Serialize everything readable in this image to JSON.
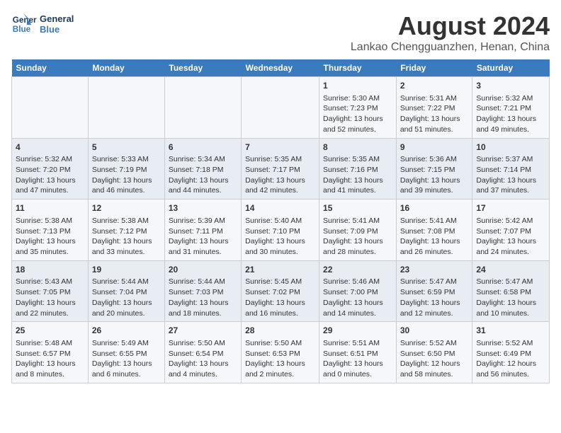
{
  "header": {
    "logo_line1": "General",
    "logo_line2": "Blue",
    "title": "August 2024",
    "subtitle": "Lankao Chengguanzhen, Henan, China"
  },
  "days_of_week": [
    "Sunday",
    "Monday",
    "Tuesday",
    "Wednesday",
    "Thursday",
    "Friday",
    "Saturday"
  ],
  "weeks": [
    [
      {
        "day": "",
        "text": ""
      },
      {
        "day": "",
        "text": ""
      },
      {
        "day": "",
        "text": ""
      },
      {
        "day": "",
        "text": ""
      },
      {
        "day": "1",
        "text": "Sunrise: 5:30 AM\nSunset: 7:23 PM\nDaylight: 13 hours and 52 minutes."
      },
      {
        "day": "2",
        "text": "Sunrise: 5:31 AM\nSunset: 7:22 PM\nDaylight: 13 hours and 51 minutes."
      },
      {
        "day": "3",
        "text": "Sunrise: 5:32 AM\nSunset: 7:21 PM\nDaylight: 13 hours and 49 minutes."
      }
    ],
    [
      {
        "day": "4",
        "text": "Sunrise: 5:32 AM\nSunset: 7:20 PM\nDaylight: 13 hours and 47 minutes."
      },
      {
        "day": "5",
        "text": "Sunrise: 5:33 AM\nSunset: 7:19 PM\nDaylight: 13 hours and 46 minutes."
      },
      {
        "day": "6",
        "text": "Sunrise: 5:34 AM\nSunset: 7:18 PM\nDaylight: 13 hours and 44 minutes."
      },
      {
        "day": "7",
        "text": "Sunrise: 5:35 AM\nSunset: 7:17 PM\nDaylight: 13 hours and 42 minutes."
      },
      {
        "day": "8",
        "text": "Sunrise: 5:35 AM\nSunset: 7:16 PM\nDaylight: 13 hours and 41 minutes."
      },
      {
        "day": "9",
        "text": "Sunrise: 5:36 AM\nSunset: 7:15 PM\nDaylight: 13 hours and 39 minutes."
      },
      {
        "day": "10",
        "text": "Sunrise: 5:37 AM\nSunset: 7:14 PM\nDaylight: 13 hours and 37 minutes."
      }
    ],
    [
      {
        "day": "11",
        "text": "Sunrise: 5:38 AM\nSunset: 7:13 PM\nDaylight: 13 hours and 35 minutes."
      },
      {
        "day": "12",
        "text": "Sunrise: 5:38 AM\nSunset: 7:12 PM\nDaylight: 13 hours and 33 minutes."
      },
      {
        "day": "13",
        "text": "Sunrise: 5:39 AM\nSunset: 7:11 PM\nDaylight: 13 hours and 31 minutes."
      },
      {
        "day": "14",
        "text": "Sunrise: 5:40 AM\nSunset: 7:10 PM\nDaylight: 13 hours and 30 minutes."
      },
      {
        "day": "15",
        "text": "Sunrise: 5:41 AM\nSunset: 7:09 PM\nDaylight: 13 hours and 28 minutes."
      },
      {
        "day": "16",
        "text": "Sunrise: 5:41 AM\nSunset: 7:08 PM\nDaylight: 13 hours and 26 minutes."
      },
      {
        "day": "17",
        "text": "Sunrise: 5:42 AM\nSunset: 7:07 PM\nDaylight: 13 hours and 24 minutes."
      }
    ],
    [
      {
        "day": "18",
        "text": "Sunrise: 5:43 AM\nSunset: 7:05 PM\nDaylight: 13 hours and 22 minutes."
      },
      {
        "day": "19",
        "text": "Sunrise: 5:44 AM\nSunset: 7:04 PM\nDaylight: 13 hours and 20 minutes."
      },
      {
        "day": "20",
        "text": "Sunrise: 5:44 AM\nSunset: 7:03 PM\nDaylight: 13 hours and 18 minutes."
      },
      {
        "day": "21",
        "text": "Sunrise: 5:45 AM\nSunset: 7:02 PM\nDaylight: 13 hours and 16 minutes."
      },
      {
        "day": "22",
        "text": "Sunrise: 5:46 AM\nSunset: 7:00 PM\nDaylight: 13 hours and 14 minutes."
      },
      {
        "day": "23",
        "text": "Sunrise: 5:47 AM\nSunset: 6:59 PM\nDaylight: 13 hours and 12 minutes."
      },
      {
        "day": "24",
        "text": "Sunrise: 5:47 AM\nSunset: 6:58 PM\nDaylight: 13 hours and 10 minutes."
      }
    ],
    [
      {
        "day": "25",
        "text": "Sunrise: 5:48 AM\nSunset: 6:57 PM\nDaylight: 13 hours and 8 minutes."
      },
      {
        "day": "26",
        "text": "Sunrise: 5:49 AM\nSunset: 6:55 PM\nDaylight: 13 hours and 6 minutes."
      },
      {
        "day": "27",
        "text": "Sunrise: 5:50 AM\nSunset: 6:54 PM\nDaylight: 13 hours and 4 minutes."
      },
      {
        "day": "28",
        "text": "Sunrise: 5:50 AM\nSunset: 6:53 PM\nDaylight: 13 hours and 2 minutes."
      },
      {
        "day": "29",
        "text": "Sunrise: 5:51 AM\nSunset: 6:51 PM\nDaylight: 13 hours and 0 minutes."
      },
      {
        "day": "30",
        "text": "Sunrise: 5:52 AM\nSunset: 6:50 PM\nDaylight: 12 hours and 58 minutes."
      },
      {
        "day": "31",
        "text": "Sunrise: 5:52 AM\nSunset: 6:49 PM\nDaylight: 12 hours and 56 minutes."
      }
    ]
  ]
}
